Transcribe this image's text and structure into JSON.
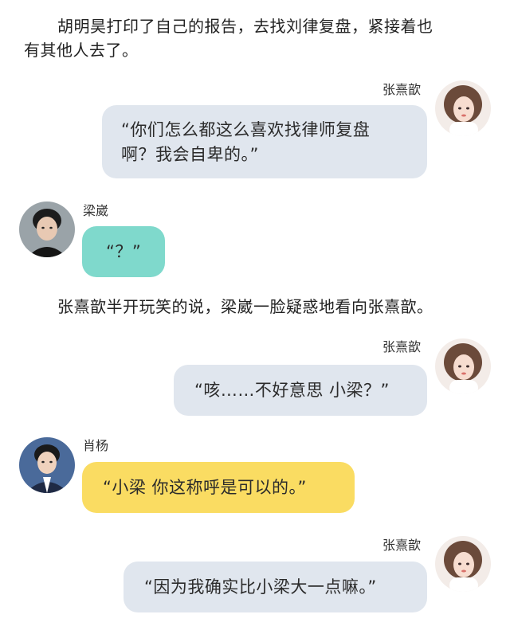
{
  "narration": {
    "line1a": "胡明昊打印了自己的报告，去找刘律复盘，紧接着也",
    "line1b": "有其他人去了。",
    "line2": "张熹歆半开玩笑的说，梁崴一脸疑惑地看向张熹歆。"
  },
  "messages": [
    {
      "speaker": "张熹歆",
      "line1": "“你们怎么都这么喜欢找律师复盘",
      "line2": "啊？我会自卑的。”"
    },
    {
      "speaker": "梁崴",
      "line1": "“？”"
    },
    {
      "speaker": "张熹歆",
      "line1": "“咳……不好意思 小梁？”"
    },
    {
      "speaker": "肖杨",
      "line1": "“小梁 你这称呼是可以的。”"
    },
    {
      "speaker": "张熹歆",
      "line1": "“因为我确实比小梁大一点嘛。”"
    }
  ],
  "avatars": {
    "zhang": "portrait-woman-avatar",
    "liang": "portrait-man-dark-avatar",
    "xiao": "portrait-man-suit-avatar"
  },
  "colors": {
    "bubble_gray": "#e0e6ee",
    "bubble_teal": "#7fd9cc",
    "bubble_yellow": "#fadc62"
  }
}
